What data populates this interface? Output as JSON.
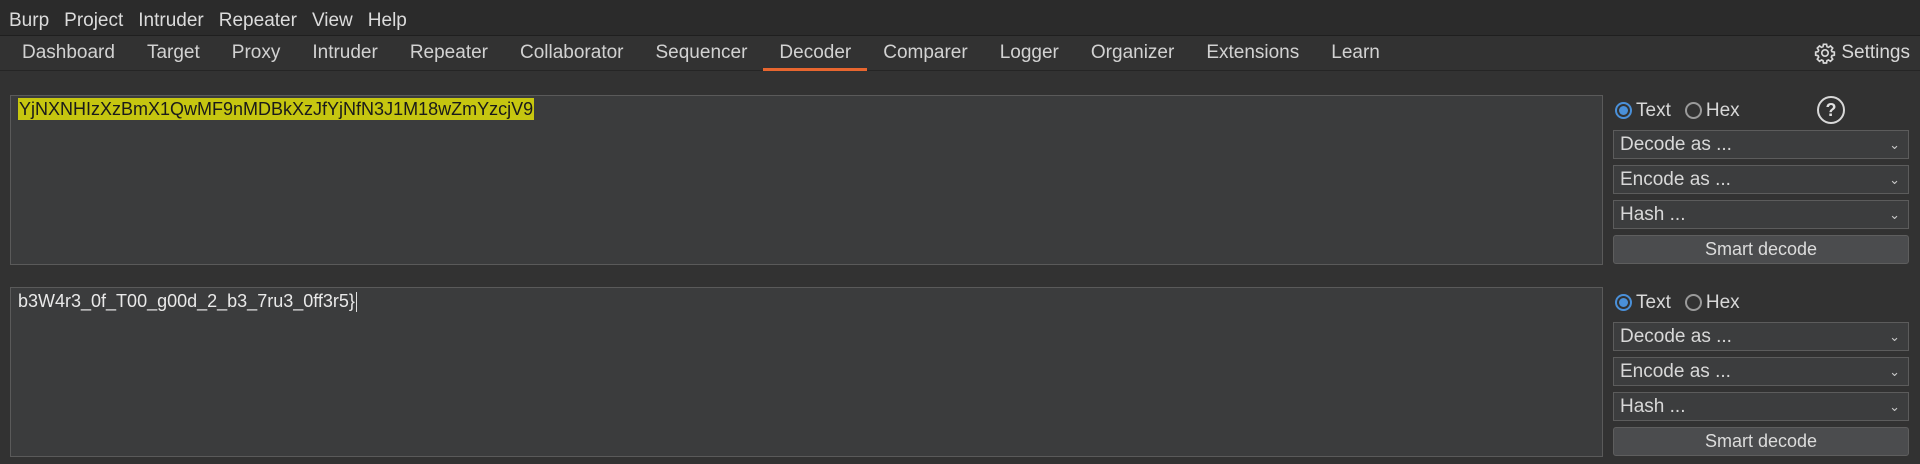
{
  "menu": [
    "Burp",
    "Project",
    "Intruder",
    "Repeater",
    "View",
    "Help"
  ],
  "tabs": [
    "Dashboard",
    "Target",
    "Proxy",
    "Intruder",
    "Repeater",
    "Collaborator",
    "Sequencer",
    "Decoder",
    "Comparer",
    "Logger",
    "Organizer",
    "Extensions",
    "Learn"
  ],
  "active_tab": "Decoder",
  "settings_label": "Settings",
  "panels": [
    {
      "content": "YjNXNHIzXzBmX1QwMF9nMDBkXzJfYjNfN3J1M18wZmYzcjV9",
      "selected": true,
      "format_text": "Text",
      "format_hex": "Hex",
      "format_selected": "Text",
      "decode_label": "Decode as ...",
      "encode_label": "Encode as ...",
      "hash_label": "Hash ...",
      "smart_label": "Smart decode"
    },
    {
      "content": "b3W4r3_0f_T00_g00d_2_b3_7ru3_0ff3r5}",
      "selected": false,
      "format_text": "Text",
      "format_hex": "Hex",
      "format_selected": "Text",
      "decode_label": "Decode as ...",
      "encode_label": "Encode as ...",
      "hash_label": "Hash ...",
      "smart_label": "Smart decode"
    }
  ],
  "help_glyph": "?",
  "colors": {
    "accent": "#e8662f",
    "selection": "#c6c610",
    "radio": "#4a90d9"
  }
}
